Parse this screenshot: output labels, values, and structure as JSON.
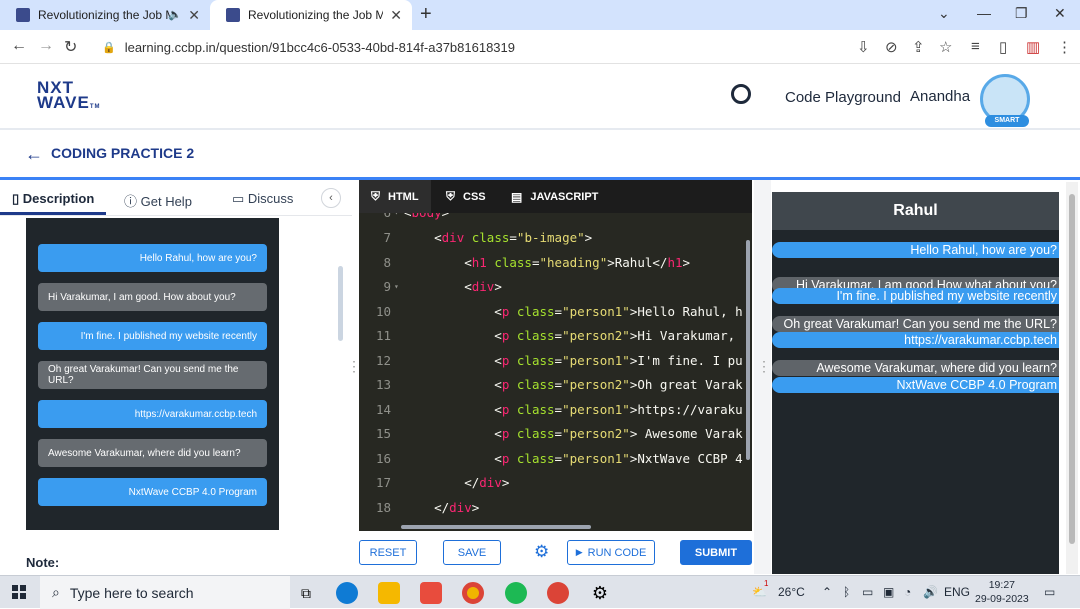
{
  "browser": {
    "tabs": [
      {
        "title": "Revolutionizing the Job Ma",
        "active": false
      },
      {
        "title": "Revolutionizing the Job Market",
        "active": true
      }
    ],
    "url": "learning.ccbp.in/question/91bcc4c6-0533-40bd-814f-a37b81618319"
  },
  "header": {
    "logo_line1": "NXT",
    "logo_line2": "WAVE",
    "logo_tm": "TM",
    "playground": "Code Playground",
    "username": "Anandha",
    "avatar_badge": "SMART"
  },
  "page": {
    "title": "CODING PRACTICE 2"
  },
  "left_tabs": {
    "description": "Description",
    "get_help": "Get Help",
    "discuss": "Discuss"
  },
  "preview_messages": [
    {
      "text": "Hello Rahul, how are you?",
      "kind": "person1"
    },
    {
      "text": "Hi Varakumar, I am good. How about you?",
      "kind": "person2"
    },
    {
      "text": "I'm fine. I published my website recently",
      "kind": "person1"
    },
    {
      "text": "Oh great Varakumar! Can you send me the URL?",
      "kind": "person2"
    },
    {
      "text": "https://varakumar.ccbp.tech",
      "kind": "person1"
    },
    {
      "text": "Awesome Varakumar, where did you learn?",
      "kind": "person2"
    },
    {
      "text": "NxtWave CCBP 4.0 Program",
      "kind": "person1"
    }
  ],
  "note_label": "Note:",
  "editor": {
    "tabs": {
      "html": "HTML",
      "css": "CSS",
      "js": "JAVASCRIPT"
    },
    "line_numbers": [
      "6",
      "7",
      "8",
      "9",
      "10",
      "11",
      "12",
      "13",
      "14",
      "15",
      "16",
      "17",
      "18"
    ]
  },
  "buttons": {
    "reset": "RESET",
    "save": "SAVE",
    "run": "RUN CODE",
    "submit": "SUBMIT"
  },
  "output": {
    "heading": "Rahul",
    "messages": [
      {
        "text": "Hello Rahul, how are you?",
        "kind": "person1"
      },
      {
        "text": "Hi Varakumar, I am good.How what about you?",
        "kind": "person2"
      },
      {
        "text": "I'm fine. I published my website recently",
        "kind": "person1"
      },
      {
        "text": "Oh great Varakumar! Can you send me the URL?",
        "kind": "person2"
      },
      {
        "text": "https://varakumar.ccbp.tech",
        "kind": "person1"
      },
      {
        "text": "Awesome Varakumar, where did you learn?",
        "kind": "person2"
      },
      {
        "text": "NxtWave CCBP 4.0 Program",
        "kind": "person1"
      }
    ]
  },
  "taskbar": {
    "search_placeholder": "Type here to search",
    "weather_badge": "1",
    "temperature": "26°C",
    "language": "ENG",
    "time": "19:27",
    "date": "29-09-2023"
  }
}
